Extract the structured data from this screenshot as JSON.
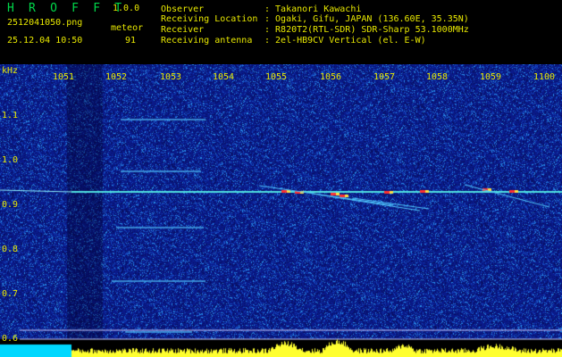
{
  "app": {
    "title": "H R O F F T",
    "version": "1.0.0"
  },
  "file": {
    "name": "2512041050.png",
    "datetime": "25.12.04 10:50"
  },
  "meteor": {
    "label": "meteor",
    "count": "91"
  },
  "info": [
    {
      "key": "Observer",
      "value": ": Takanori Kawachi"
    },
    {
      "key": "Receiving Location",
      "value": ": Ogaki, Gifu, JAPAN (136.60E, 35.35N)"
    },
    {
      "key": "Receiver",
      "value": ": R820T2(RTL-SDR) SDR-Sharp 53.1000MHz"
    },
    {
      "key": "Receiving antenna",
      "value": ": 2el-HB9CV Vertical (el. E-W)"
    }
  ],
  "axis": {
    "y_unit": "kHz",
    "y_ticks": [
      "1.1",
      "1.0",
      "0.9",
      "0.8",
      "0.7",
      "0.6"
    ],
    "x_ticks": [
      "1051",
      "1052",
      "1053",
      "1054",
      "1055",
      "1056",
      "1057",
      "1058",
      "1059",
      "1100"
    ]
  },
  "colors": {
    "header_text": "#e8e800",
    "title_green": "#00d84a",
    "background": "#000000"
  }
}
